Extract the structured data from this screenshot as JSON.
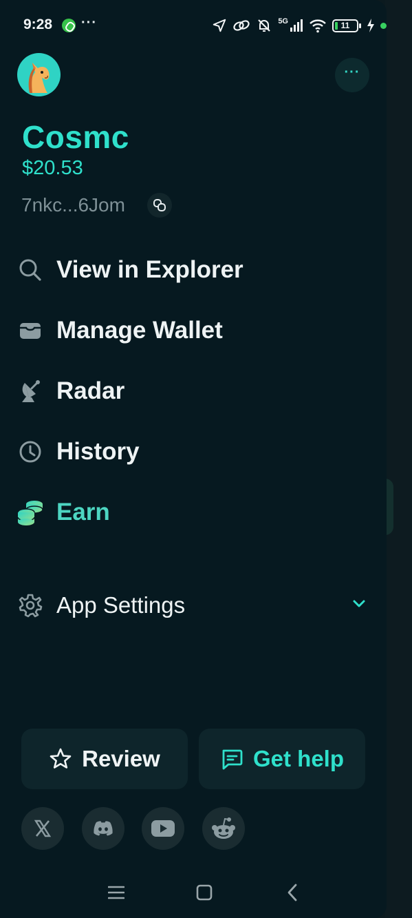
{
  "status_bar": {
    "time": "9:28",
    "dots": "···",
    "network": "5G",
    "battery": "11"
  },
  "header": {
    "avatar_icon": "horse-avatar-icon",
    "more_icon": "more-dots-icon",
    "more_glyph": "···"
  },
  "wallet": {
    "name": "Cosmc",
    "balance": "$20.53",
    "address": "7nkc...6Jom"
  },
  "menu": {
    "items": [
      {
        "label": "View in Explorer",
        "icon": "search-icon"
      },
      {
        "label": "Manage Wallet",
        "icon": "wallet-icon"
      },
      {
        "label": "Radar",
        "icon": "satellite-dish-icon"
      },
      {
        "label": "History",
        "icon": "clock-icon"
      },
      {
        "label": "Earn",
        "icon": "coins-icon"
      }
    ],
    "settings": {
      "label": "App Settings",
      "icon": "gear-icon"
    }
  },
  "actions": {
    "review_label": "Review",
    "help_label": "Get help"
  },
  "social": [
    "x-icon",
    "discord-icon",
    "youtube-icon",
    "reddit-icon"
  ],
  "colors": {
    "accent": "#2fe0cb",
    "background": "#061920",
    "text": "#eef3f4",
    "muted": "#7e9096"
  }
}
